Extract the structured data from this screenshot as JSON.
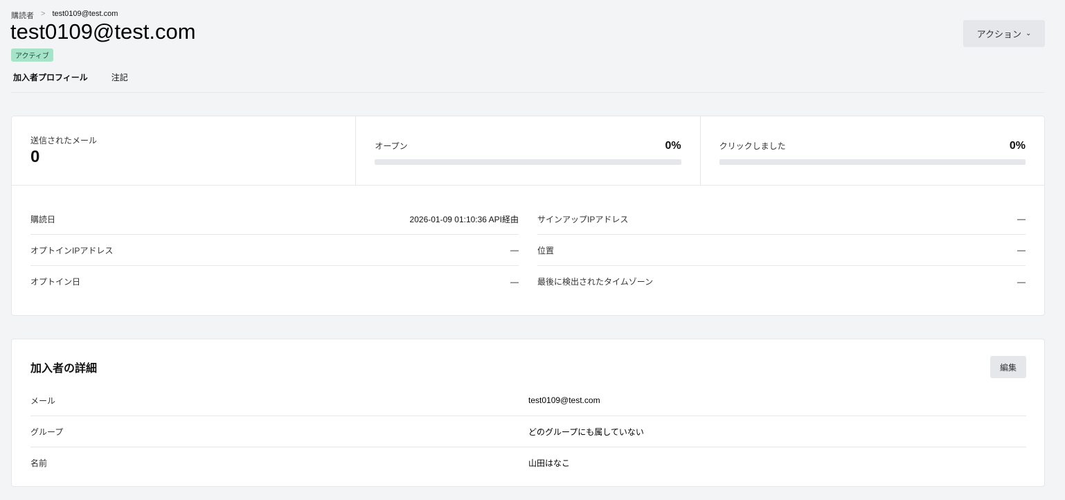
{
  "breadcrumb": {
    "parent": "購読者",
    "separator": ">",
    "current": "test0109@test.com"
  },
  "title": "test0109@test.com",
  "status": "アクティブ",
  "tabs": [
    "加入者プロフィール",
    "注記"
  ],
  "action_label": "アクション",
  "stats": {
    "sent_label": "送信されたメール",
    "sent_value": "0",
    "open_label": "オープン",
    "open_value": "0%",
    "click_label": "クリックしました",
    "click_value": "0%"
  },
  "info_left": [
    {
      "k": "購読日",
      "v": "2026-01-09 01:10:36 API経由"
    },
    {
      "k": "オプトインIPアドレス",
      "v": "—"
    },
    {
      "k": "オプトイン日",
      "v": "—"
    }
  ],
  "info_right": [
    {
      "k": "サインアップIPアドレス",
      "v": "—"
    },
    {
      "k": "位置",
      "v": "—"
    },
    {
      "k": "最後に検出されたタイムゾーン",
      "v": "—"
    }
  ],
  "details": {
    "title": "加入者の詳細",
    "edit_label": "編集",
    "rows": [
      {
        "k": "メール",
        "v": "test0109@test.com"
      },
      {
        "k": "グループ",
        "v": "どのグループにも属していない"
      },
      {
        "k": "名前",
        "v": "山田はなこ"
      }
    ]
  }
}
